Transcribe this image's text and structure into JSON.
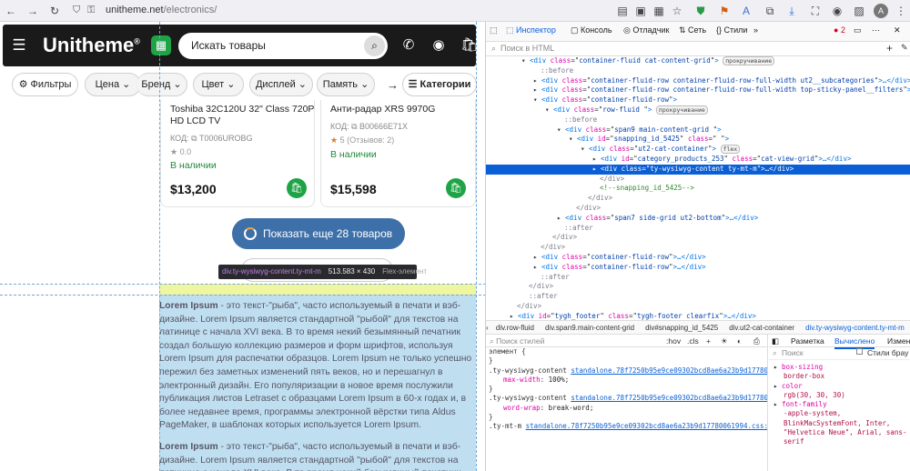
{
  "browser": {
    "url_domain": "unitheme.net",
    "url_path": "/electronics/"
  },
  "site": {
    "logo_main": "Unitheme",
    "logo_mark": "®",
    "search_placeholder": "Искать товары",
    "filters": [
      {
        "label": "Фильтры"
      },
      {
        "label": "Цена"
      },
      {
        "label": "Бренд"
      },
      {
        "label": "Цвет"
      },
      {
        "label": "Дисплей"
      },
      {
        "label": "Память"
      }
    ],
    "categories_label": "Категории",
    "products": [
      {
        "name": "Toshiba 32C120U 32\" Class 720P HD LCD TV",
        "code_label": "КОД:",
        "code": "T0006UROBG",
        "rating": "0.0",
        "stock": "В наличии",
        "price": "$13,200"
      },
      {
        "name": "Анти-радар XRS 9970G",
        "code_label": "КОД:",
        "code": "B00666E71X",
        "rating": "5 (Отзывов: 2)",
        "stock": "В наличии",
        "price": "$15,598"
      }
    ],
    "more_button": "Показать еще 28 товаров",
    "lorem_lead": "Lorem Ipsum",
    "lorem_text": " - это текст-\"рыба\", часто используемый в печати и вэб-дизайне. Lorem Ipsum является стандартной \"рыбой\" для текстов на латинице с начала XVI века. В то время некий безымянный печатник создал большую коллекцию размеров и форм шрифтов, используя Lorem Ipsum для распечатки образцов. Lorem Ipsum не только успешно пережил без заметных изменений пять веков, но и перешагнул в электронный дизайн. Его популяризации в новое время послужили публикация листов Letraset с образцами Lorem Ipsum в 60-х годах и, в более недавнее время, программы электронной вёрстки типа Aldus PageMaker, в шаблонах которых используется Lorem Ipsum.",
    "lorem_text2": " - это текст-\"рыба\", часто используемый в печати и вэб-дизайне. Lorem Ipsum является стандартной \"рыбой\" для текстов на латинице с начала XVI века. В то время некий безымянный печатник",
    "tooltip": {
      "selector": "div.ty-wysiwyg-content.ty-mt-m",
      "size": "513.583 × 430",
      "kind": "Flex-элемент"
    }
  },
  "devtools": {
    "tabs": [
      "Инспектор",
      "Консоль",
      "Отладчик",
      "Сеть",
      "Стили"
    ],
    "error_count": "2",
    "search_placeholder": "Поиск в HTML",
    "tree": [
      {
        "indent": 3,
        "kind": "open",
        "tag": "div",
        "attrs": [
          [
            "class",
            "container-fluid cat-content-grid"
          ]
        ],
        "close": ">",
        "badge": "прокручивание"
      },
      {
        "indent": 4,
        "kind": "pseudo",
        "text": "::before"
      },
      {
        "indent": 4,
        "kind": "el",
        "tag": "div",
        "attrs": [
          [
            "class",
            "container-fluid-row container-fluid-row-full-width ut2__subcategories"
          ]
        ],
        "close": ">…</div>",
        "tw": true
      },
      {
        "indent": 4,
        "kind": "el",
        "tag": "div",
        "attrs": [
          [
            "class",
            "container-fluid-row container-fluid-row-full-width top-sticky-panel__filters"
          ]
        ],
        "close": ">…</div>",
        "tw": true
      },
      {
        "indent": 4,
        "kind": "open",
        "tag": "div",
        "attrs": [
          [
            "class",
            "container-fluid-row"
          ]
        ],
        "close": ">"
      },
      {
        "indent": 5,
        "kind": "open",
        "tag": "div",
        "attrs": [
          [
            "class",
            "row-fluid "
          ]
        ],
        "close": ">",
        "badge": "прокручивание"
      },
      {
        "indent": 6,
        "kind": "pseudo",
        "text": "::before"
      },
      {
        "indent": 6,
        "kind": "open",
        "tag": "div",
        "attrs": [
          [
            "class",
            "span9 main-content-grid "
          ]
        ],
        "close": ">"
      },
      {
        "indent": 7,
        "kind": "open",
        "tag": "div",
        "attrs": [
          [
            "id",
            "snapping_id_5425"
          ],
          [
            "class",
            " "
          ]
        ],
        "close": ">"
      },
      {
        "indent": 8,
        "kind": "open",
        "tag": "div",
        "attrs": [
          [
            "class",
            "ut2-cat-container"
          ]
        ],
        "close": ">",
        "badge": "flex"
      },
      {
        "indent": 9,
        "kind": "el",
        "tag": "div",
        "attrs": [
          [
            "id",
            "category_products_253"
          ],
          [
            "class",
            "cat-view-grid"
          ]
        ],
        "close": ">…</div>",
        "tw": true
      },
      {
        "indent": 9,
        "kind": "el",
        "tag": "div",
        "attrs": [
          [
            "class",
            "ty-wysiwyg-content ty-mt-m"
          ]
        ],
        "close": ">…</div>",
        "tw": true,
        "selected": true
      },
      {
        "indent": 9,
        "kind": "pseudo",
        "text": "</div>"
      },
      {
        "indent": 9,
        "kind": "comment",
        "text": "<!--snapping_id_5425-->"
      },
      {
        "indent": 8,
        "kind": "pseudo",
        "text": "</div>"
      },
      {
        "indent": 7,
        "kind": "pseudo",
        "text": "</div>"
      },
      {
        "indent": 6,
        "kind": "el",
        "tag": "div",
        "attrs": [
          [
            "class",
            "span7 side-grid ut2-bottom"
          ]
        ],
        "close": ">…</div>",
        "tw": true
      },
      {
        "indent": 6,
        "kind": "pseudo",
        "text": "::after"
      },
      {
        "indent": 5,
        "kind": "pseudo",
        "text": "</div>"
      },
      {
        "indent": 4,
        "kind": "pseudo",
        "text": "</div>"
      },
      {
        "indent": 4,
        "kind": "el",
        "tag": "div",
        "attrs": [
          [
            "class",
            "container-fluid-row"
          ]
        ],
        "close": ">…</div>",
        "tw": true
      },
      {
        "indent": 4,
        "kind": "el",
        "tag": "div",
        "attrs": [
          [
            "class",
            "container-fluid-row"
          ]
        ],
        "close": ">…</div>",
        "tw": true
      },
      {
        "indent": 4,
        "kind": "pseudo",
        "text": "::after"
      },
      {
        "indent": 3,
        "kind": "pseudo",
        "text": "</div>"
      },
      {
        "indent": 3,
        "kind": "pseudo",
        "text": "::after"
      },
      {
        "indent": 2,
        "kind": "pseudo",
        "text": "</div>"
      },
      {
        "indent": 2,
        "kind": "el",
        "tag": "div",
        "attrs": [
          [
            "id",
            "tygh_footer"
          ],
          [
            "class",
            "tygh-footer clearfix"
          ]
        ],
        "close": ">…</div>",
        "tw": true
      }
    ],
    "breadcrumbs": [
      "div.row-fluid",
      "div.span9.main-content-grid",
      "div#snapping_id_5425",
      "div.ut2-cat-container",
      "div.ty-wysiwyg-content.ty-mt-m"
    ],
    "styles_search_placeholder": "Поиск стилей",
    "styles_toggles": [
      ":hov",
      ".cls"
    ],
    "rules": [
      {
        "type": "head",
        "selector": "элемент",
        "after": " {"
      },
      {
        "type": "plain",
        "text": "}"
      },
      {
        "type": "link",
        "selector": ".ty-wysiwyg-content ",
        "file": "standalone.78f7250b95e9ce09302bcd8ae6a23b9d17780061994.css:1045"
      },
      {
        "type": "prop",
        "name": "max-width",
        "value": "100%;"
      },
      {
        "type": "plain",
        "text": "}"
      },
      {
        "type": "link",
        "selector": ".ty-wysiwyg-content ",
        "file": "standalone.78f7250b95e9ce09302bcd8ae6a23b9d17780061994.css:1045"
      },
      {
        "type": "prop",
        "name": "word-wrap",
        "value": "break-word;"
      },
      {
        "type": "plain",
        "text": "}"
      },
      {
        "type": "link",
        "selector": ".ty-mt-m ",
        "file": "standalone.78f7250b95e9ce09302bcd8ae6a23b9d17780061994.css:1045"
      }
    ],
    "layout_tabs": [
      "Разметка",
      "Вычислено",
      "Измен"
    ],
    "layout_search_placeholder": "Поиск",
    "layout_checkbox": "Стили брау",
    "computed": [
      {
        "name": "box-sizing",
        "value": "border-box"
      },
      {
        "name": "color",
        "value": "rgb(30, 30, 30)"
      },
      {
        "name": "font-family",
        "value": "-apple-system, BlinkMacSystemFont, Inter, \"Helvetica Neue\", Arial, sans-serif"
      }
    ]
  }
}
